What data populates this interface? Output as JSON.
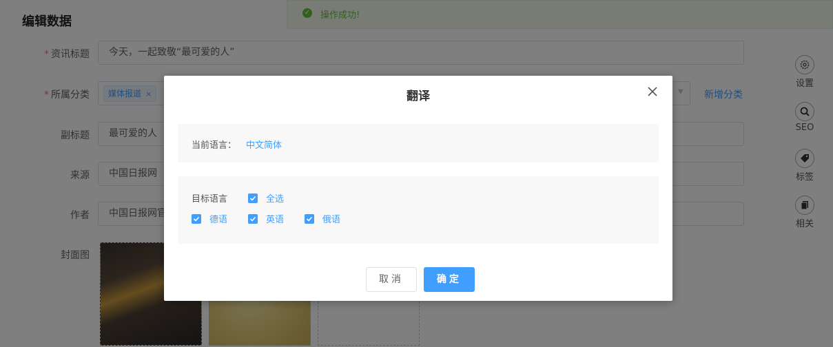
{
  "page": {
    "title": "编辑数据",
    "toast": "操作成功!"
  },
  "form": {
    "news_title": {
      "label": "资讯标题",
      "value": "今天，一起致敬“最可爱的人”"
    },
    "category": {
      "label": "所属分类",
      "tag": "媒体报道",
      "add_link": "新增分类"
    },
    "subtitle": {
      "label": "副标题",
      "value": "最可爱的人"
    },
    "source": {
      "label": "来源",
      "value": "中国日报网"
    },
    "author": {
      "label": "作者",
      "value": "中国日报网官"
    },
    "cover": {
      "label": "封面图"
    }
  },
  "side_tools": [
    {
      "label": "设置",
      "icon": "gear-icon"
    },
    {
      "label": "SEO",
      "icon": "search-icon"
    },
    {
      "label": "标签",
      "icon": "tag-icon"
    },
    {
      "label": "相关",
      "icon": "copy-icon"
    }
  ],
  "dialog": {
    "title": "翻译",
    "current_label": "当前语言：",
    "current_value": "中文简体",
    "target_label": "目标语言",
    "select_all": "全选",
    "languages": [
      "德语",
      "英语",
      "俄语"
    ],
    "cancel": "取消",
    "confirm": "确定"
  },
  "colors": {
    "primary": "#409eff",
    "success": "#67c23a",
    "required": "#f56c6c"
  }
}
